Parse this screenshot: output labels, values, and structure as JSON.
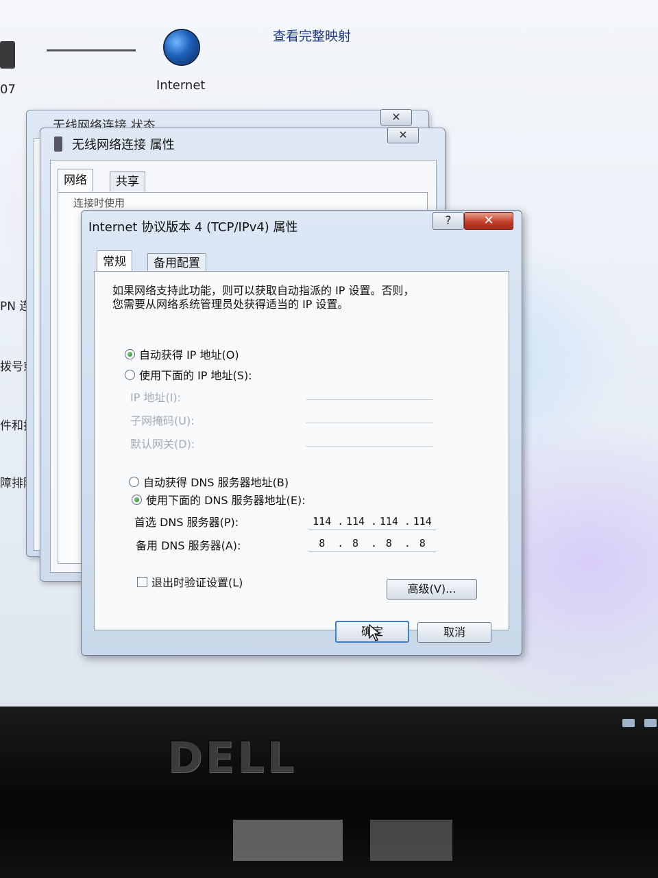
{
  "network_map": {
    "view_full_map": "查看完整映射",
    "internet_label": "Internet",
    "computer_label_fragment": "07"
  },
  "left_panel_fragments": [
    "PN 连",
    "拨号或",
    "件和打印",
    "障排除信"
  ],
  "status_window": {
    "title": "无线网络连接 状态",
    "close": "✕"
  },
  "properties_window": {
    "title": "无线网络连接 属性",
    "close": "✕",
    "tabs": [
      "网络",
      "共享"
    ],
    "fragment": "连接时使用"
  },
  "tcpip_dialog": {
    "title": "Internet 协议版本 4 (TCP/IPv4) 属性",
    "help": "?",
    "close": "✕",
    "tabs": [
      "常规",
      "备用配置"
    ],
    "intro_line1": "如果网络支持此功能，则可以获取自动指派的 IP 设置。否则，",
    "intro_line2": "您需要从网络系统管理员处获得适当的 IP 设置。",
    "ip": {
      "auto_label": "自动获得 IP 地址(O)",
      "auto_selected": true,
      "manual_label": "使用下面的 IP 地址(S):",
      "manual_selected": false,
      "address_label": "IP 地址(I):",
      "mask_label": "子网掩码(U):",
      "gateway_label": "默认网关(D):"
    },
    "dns": {
      "auto_label": "自动获得 DNS 服务器地址(B)",
      "auto_selected": false,
      "manual_label": "使用下面的 DNS 服务器地址(E):",
      "manual_selected": true,
      "preferred_label": "首选 DNS 服务器(P):",
      "preferred": [
        "114",
        "114",
        "114",
        "114"
      ],
      "alternate_label": "备用 DNS 服务器(A):",
      "alternate": [
        "8",
        "8",
        "8",
        "8"
      ]
    },
    "validate_label": "退出时验证设置(L)",
    "validate_checked": false,
    "advanced_button": "高级(V)...",
    "ok_button": "确定",
    "cancel_button": "取消"
  },
  "bezel": {
    "brand": "DELL"
  },
  "colors": {
    "accent_focus": "#3a7fd1",
    "close_red": "#c3402b",
    "radio_selected": "#1f7a2a"
  }
}
